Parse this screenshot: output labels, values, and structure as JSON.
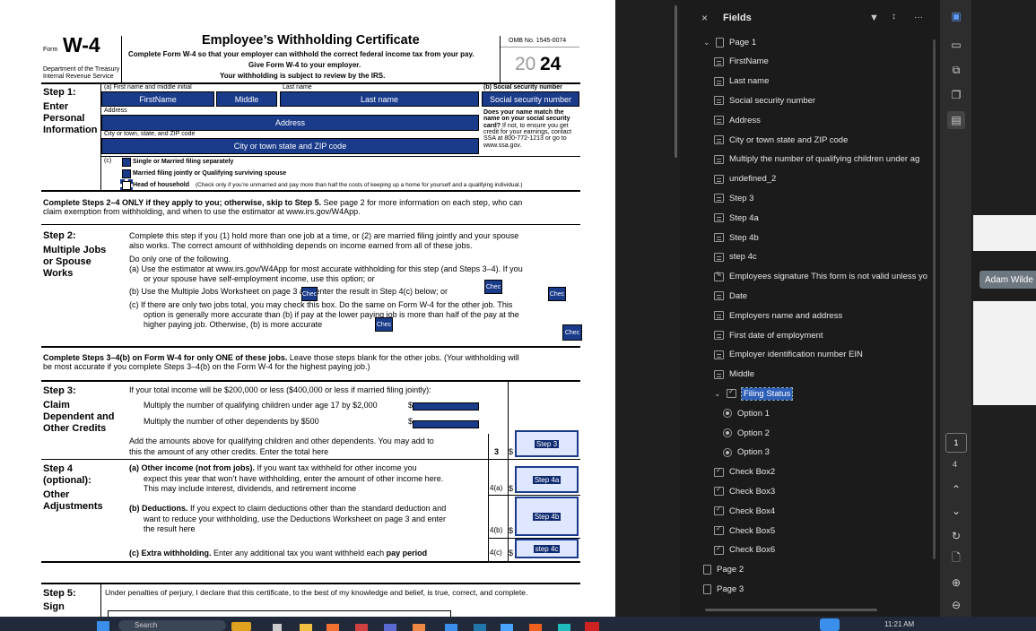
{
  "form": {
    "form_word": "Form",
    "form_number": "W-4",
    "dept": "Department of the Treasury",
    "irs": "Internal Revenue Service",
    "title": "Employee’s Withholding Certificate",
    "subtitle1": "Complete Form W-4 so that your employer can withhold the correct federal income tax from your pay.",
    "subtitle2": "Give Form W-4 to your employer.",
    "subtitle3": "Your withholding is subject to review by the IRS.",
    "omb": "OMB No. 1545-0074",
    "year_prefix": "20",
    "year_suffix": "24",
    "step1_title": "Step 1:",
    "step1_sub": "Enter Personal Information",
    "label_a": "(a)   First name and middle initial",
    "label_last": "Last name",
    "label_b": "(b)   Social security number",
    "label_address": "Address",
    "label_city": "City or town, state, and ZIP code",
    "field_first": "FirstName",
    "field_middle": "Middle",
    "field_last": "Last name",
    "field_ssn": "Social security number",
    "field_address": "Address",
    "field_city": "City or town state and ZIP code",
    "ssn_note_bold": "Does your name match the name on your social security card?",
    "ssn_note": "If not, to ensure you get credit for your earnings, contact SSA at 800-772-1213 or go to www.ssa.gov.",
    "c_label": "(c)",
    "c_single": "Single or Married filing separately",
    "c_married": "Married filing jointly or Qualifying surviving spouse",
    "c_hoh": "Head of household",
    "c_hoh_note": "(Check only if you’re unmarried and pay more than half the costs of keeping up a home for yourself and a qualifying individual.)",
    "complete_2_4": "Complete Steps 2–4 ONLY if they apply to you; otherwise, skip to Step 5.",
    "complete_2_4_rest": "See page 2 for more information on each step, who can",
    "complete_2_4_line2": "claim exemption from withholding, and when to use the estimator at www.irs.gov/W4App.",
    "step2_title": "Step 2:",
    "step2_sub": "Multiple Jobs or Spouse Works",
    "step2_l1": "Complete this step if you (1) hold more than one job at a time, or (2) are married filing jointly and your spouse",
    "step2_l2": "also works. The correct amount of withholding depends on income earned from all of these jobs.",
    "step2_l3": "Do only one of the following.",
    "step2_a1": "(a)  Use the estimator at www.irs.gov/W4App for most accurate withholding for this step (and Steps 3–4). If you",
    "step2_a2": "or your spouse have self-employment income, use this option; or",
    "step2_b": "(b)  Use the Multiple Jobs Worksheet on page 3 and enter the result in Step 4(c) below; or",
    "step2_c1": "(c)  If there are only two jobs total, you may check this box. Do the same on Form W-4 for the other job. This",
    "step2_c2": "option is generally more accurate than (b) if pay at the lower paying job is more than half of the pay at the",
    "step2_c3": "higher paying job. Otherwise, (b) is more accurate",
    "chk_label": "Chec",
    "complete_3_4b": "Complete Steps 3–4(b) on Form W-4 for only ONE of these jobs.",
    "complete_3_4b_rest": "Leave those steps blank for the other jobs. (Your withholding will",
    "complete_3_4b_l2": "be most accurate if you complete Steps 3–4(b) on the Form W-4 for the highest paying job.)",
    "step3_title": "Step 3:",
    "step3_sub": "Claim Dependent and Other Credits",
    "step3_l1": "If your total income will be $200,000 or less ($400,000 or less if married filing jointly):",
    "step3_l2": "Multiply the number of qualifying children under age 17 by $2,000",
    "step3_l3": "Multiply the number of other dependents by $500",
    "step3_l4": "Add the amounts above for qualifying children and other dependents. You may add to",
    "step3_l5": "this the amount of any other credits. Enter the total here",
    "line3": "3",
    "field_step3": "Step 3",
    "step4_title": "Step 4",
    "step4_opt": "(optional):",
    "step4_sub": "Other Adjustments",
    "step4a_1": "(a)  Other income (not from jobs).",
    "step4a_1r": "If you want tax withheld for other income you",
    "step4a_2": "expect this year that won’t have withholding, enter the amount of other income here.",
    "step4a_3": "This may include interest, dividends, and retirement income",
    "line4a": "4(a)",
    "field_step4a": "Step 4a",
    "step4b_1": "(b)  Deductions.",
    "step4b_1r": "If you expect to claim deductions other than the standard deduction and",
    "step4b_2": "want to reduce your withholding, use the Deductions Worksheet on page 3 and enter",
    "step4b_3": "the result here",
    "line4b": "4(b)",
    "field_step4b": "Step 4b",
    "step4c_1": "(c)  Extra withholding.",
    "step4c_1r": "Enter any additional tax you want withheld each",
    "step4c_pay": "pay period",
    "line4c": "4(c)",
    "field_step4c": "step 4c",
    "dollar": "$",
    "step5_title": "Step 5:",
    "step5_sub": "Sign",
    "step5_text": "Under penalties of perjury, I declare that this certificate, to the best of my knowledge and belief, is true, correct, and complete."
  },
  "panel": {
    "title": "Fields",
    "close": "×",
    "more": "···",
    "items": [
      {
        "label": "Page 1",
        "kind": "page",
        "chev": "⌄"
      },
      {
        "label": "FirstName",
        "kind": "text"
      },
      {
        "label": "Last name",
        "kind": "text"
      },
      {
        "label": "Social security number",
        "kind": "text"
      },
      {
        "label": "Address",
        "kind": "text"
      },
      {
        "label": "City or town state and ZIP code",
        "kind": "text"
      },
      {
        "label": "Multiply the number of qualifying children under ag",
        "kind": "text"
      },
      {
        "label": "undefined_2",
        "kind": "text"
      },
      {
        "label": "Step 3",
        "kind": "text"
      },
      {
        "label": "Step 4a",
        "kind": "text"
      },
      {
        "label": "Step 4b",
        "kind": "text"
      },
      {
        "label": "step 4c",
        "kind": "text"
      },
      {
        "label": "Employees signature This form is not valid unless yo",
        "kind": "sig"
      },
      {
        "label": "Date",
        "kind": "text"
      },
      {
        "label": "Employers name and address",
        "kind": "text"
      },
      {
        "label": "First date of employment",
        "kind": "text"
      },
      {
        "label": "Employer identification number EIN",
        "kind": "text"
      },
      {
        "label": "Middle",
        "kind": "text"
      },
      {
        "label": "Filing Status",
        "kind": "radiogroup",
        "chev": "⌄",
        "selected": true
      },
      {
        "label": "Option 1",
        "kind": "radio"
      },
      {
        "label": "Option 2",
        "kind": "radio"
      },
      {
        "label": "Option 3",
        "kind": "radio"
      },
      {
        "label": "Check Box2",
        "kind": "check"
      },
      {
        "label": "Check Box3",
        "kind": "check"
      },
      {
        "label": "Check Box4",
        "kind": "check"
      },
      {
        "label": "Check Box5",
        "kind": "check"
      },
      {
        "label": "Check Box6",
        "kind": "check"
      },
      {
        "label": "Page 2",
        "kind": "page"
      },
      {
        "label": "Page 3",
        "kind": "page"
      }
    ]
  },
  "rail": {
    "page_current": "1",
    "page_total": "4"
  },
  "collab": {
    "name": "Adam Wilde"
  },
  "taskbar": {
    "search": "Search",
    "time": "11:21 AM"
  }
}
